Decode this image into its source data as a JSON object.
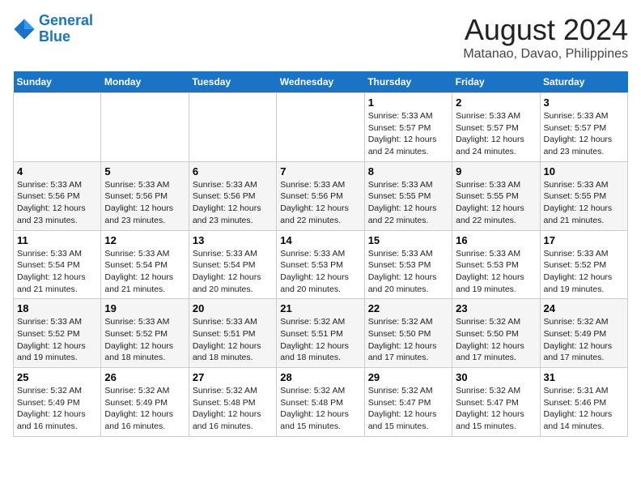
{
  "header": {
    "logo_line1": "General",
    "logo_line2": "Blue",
    "title": "August 2024",
    "subtitle": "Matanao, Davao, Philippines"
  },
  "weekdays": [
    "Sunday",
    "Monday",
    "Tuesday",
    "Wednesday",
    "Thursday",
    "Friday",
    "Saturday"
  ],
  "weeks": [
    [
      {
        "day": "",
        "info": ""
      },
      {
        "day": "",
        "info": ""
      },
      {
        "day": "",
        "info": ""
      },
      {
        "day": "",
        "info": ""
      },
      {
        "day": "1",
        "info": "Sunrise: 5:33 AM\nSunset: 5:57 PM\nDaylight: 12 hours\nand 24 minutes."
      },
      {
        "day": "2",
        "info": "Sunrise: 5:33 AM\nSunset: 5:57 PM\nDaylight: 12 hours\nand 24 minutes."
      },
      {
        "day": "3",
        "info": "Sunrise: 5:33 AM\nSunset: 5:57 PM\nDaylight: 12 hours\nand 23 minutes."
      }
    ],
    [
      {
        "day": "4",
        "info": "Sunrise: 5:33 AM\nSunset: 5:56 PM\nDaylight: 12 hours\nand 23 minutes."
      },
      {
        "day": "5",
        "info": "Sunrise: 5:33 AM\nSunset: 5:56 PM\nDaylight: 12 hours\nand 23 minutes."
      },
      {
        "day": "6",
        "info": "Sunrise: 5:33 AM\nSunset: 5:56 PM\nDaylight: 12 hours\nand 23 minutes."
      },
      {
        "day": "7",
        "info": "Sunrise: 5:33 AM\nSunset: 5:56 PM\nDaylight: 12 hours\nand 22 minutes."
      },
      {
        "day": "8",
        "info": "Sunrise: 5:33 AM\nSunset: 5:55 PM\nDaylight: 12 hours\nand 22 minutes."
      },
      {
        "day": "9",
        "info": "Sunrise: 5:33 AM\nSunset: 5:55 PM\nDaylight: 12 hours\nand 22 minutes."
      },
      {
        "day": "10",
        "info": "Sunrise: 5:33 AM\nSunset: 5:55 PM\nDaylight: 12 hours\nand 21 minutes."
      }
    ],
    [
      {
        "day": "11",
        "info": "Sunrise: 5:33 AM\nSunset: 5:54 PM\nDaylight: 12 hours\nand 21 minutes."
      },
      {
        "day": "12",
        "info": "Sunrise: 5:33 AM\nSunset: 5:54 PM\nDaylight: 12 hours\nand 21 minutes."
      },
      {
        "day": "13",
        "info": "Sunrise: 5:33 AM\nSunset: 5:54 PM\nDaylight: 12 hours\nand 20 minutes."
      },
      {
        "day": "14",
        "info": "Sunrise: 5:33 AM\nSunset: 5:53 PM\nDaylight: 12 hours\nand 20 minutes."
      },
      {
        "day": "15",
        "info": "Sunrise: 5:33 AM\nSunset: 5:53 PM\nDaylight: 12 hours\nand 20 minutes."
      },
      {
        "day": "16",
        "info": "Sunrise: 5:33 AM\nSunset: 5:53 PM\nDaylight: 12 hours\nand 19 minutes."
      },
      {
        "day": "17",
        "info": "Sunrise: 5:33 AM\nSunset: 5:52 PM\nDaylight: 12 hours\nand 19 minutes."
      }
    ],
    [
      {
        "day": "18",
        "info": "Sunrise: 5:33 AM\nSunset: 5:52 PM\nDaylight: 12 hours\nand 19 minutes."
      },
      {
        "day": "19",
        "info": "Sunrise: 5:33 AM\nSunset: 5:52 PM\nDaylight: 12 hours\nand 18 minutes."
      },
      {
        "day": "20",
        "info": "Sunrise: 5:33 AM\nSunset: 5:51 PM\nDaylight: 12 hours\nand 18 minutes."
      },
      {
        "day": "21",
        "info": "Sunrise: 5:32 AM\nSunset: 5:51 PM\nDaylight: 12 hours\nand 18 minutes."
      },
      {
        "day": "22",
        "info": "Sunrise: 5:32 AM\nSunset: 5:50 PM\nDaylight: 12 hours\nand 17 minutes."
      },
      {
        "day": "23",
        "info": "Sunrise: 5:32 AM\nSunset: 5:50 PM\nDaylight: 12 hours\nand 17 minutes."
      },
      {
        "day": "24",
        "info": "Sunrise: 5:32 AM\nSunset: 5:49 PM\nDaylight: 12 hours\nand 17 minutes."
      }
    ],
    [
      {
        "day": "25",
        "info": "Sunrise: 5:32 AM\nSunset: 5:49 PM\nDaylight: 12 hours\nand 16 minutes."
      },
      {
        "day": "26",
        "info": "Sunrise: 5:32 AM\nSunset: 5:49 PM\nDaylight: 12 hours\nand 16 minutes."
      },
      {
        "day": "27",
        "info": "Sunrise: 5:32 AM\nSunset: 5:48 PM\nDaylight: 12 hours\nand 16 minutes."
      },
      {
        "day": "28",
        "info": "Sunrise: 5:32 AM\nSunset: 5:48 PM\nDaylight: 12 hours\nand 15 minutes."
      },
      {
        "day": "29",
        "info": "Sunrise: 5:32 AM\nSunset: 5:47 PM\nDaylight: 12 hours\nand 15 minutes."
      },
      {
        "day": "30",
        "info": "Sunrise: 5:32 AM\nSunset: 5:47 PM\nDaylight: 12 hours\nand 15 minutes."
      },
      {
        "day": "31",
        "info": "Sunrise: 5:31 AM\nSunset: 5:46 PM\nDaylight: 12 hours\nand 14 minutes."
      }
    ]
  ]
}
